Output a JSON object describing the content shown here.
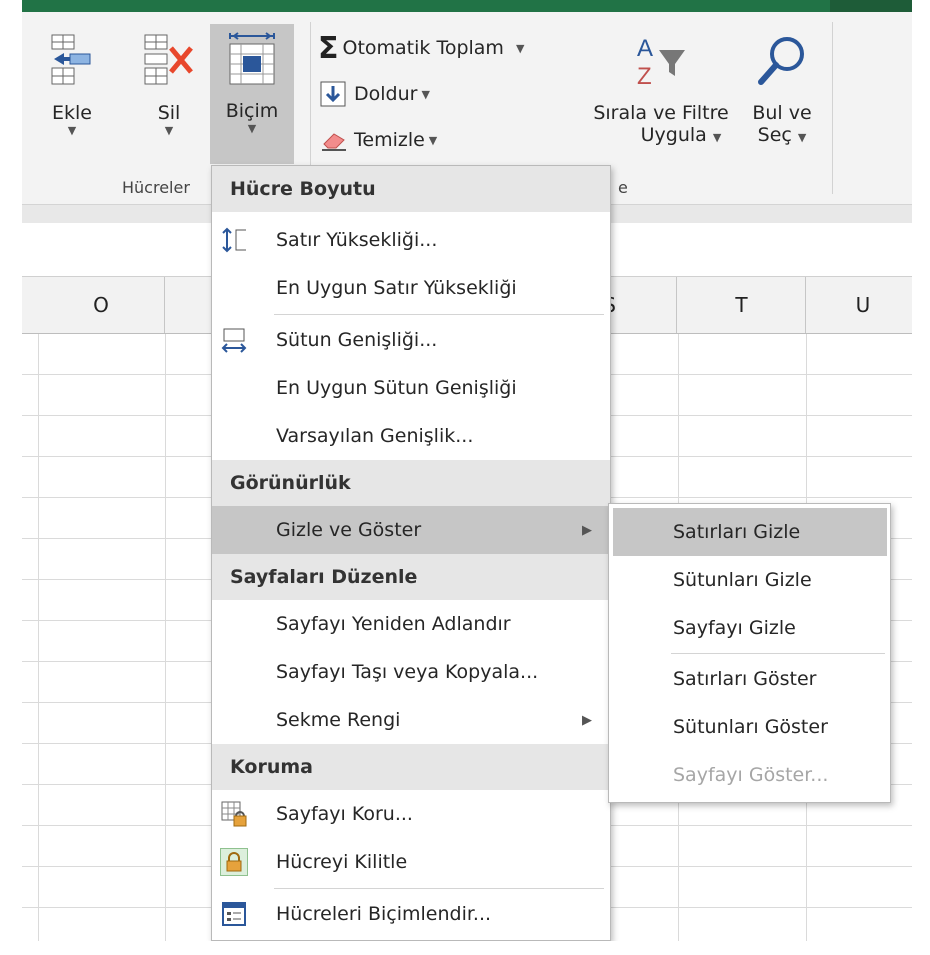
{
  "ribbon": {
    "buttons": {
      "insert": "Ekle",
      "delete": "Sil",
      "format": "Biçim",
      "autosum": "Otomatik Toplam",
      "fill": "Doldur",
      "clear": "Temizle",
      "sort_line1": "Sırala ve Filtre",
      "sort_line2": "Uygula",
      "find_line1": "Bul ve",
      "find_line2": "Seç"
    },
    "groups": {
      "cells": "Hücreler",
      "editing_partial": "e"
    }
  },
  "columns": [
    "O",
    "",
    "",
    "S",
    "T",
    "U"
  ],
  "format_menu": {
    "sections": {
      "cell_size": "Hücre Boyutu",
      "visibility": "Görünürlük",
      "organize_sheets": "Sayfaları Düzenle",
      "protection": "Koruma"
    },
    "items": {
      "row_height": "Satır Yüksekliği...",
      "autofit_row_height": "En Uygun Satır Yüksekliği",
      "column_width": "Sütun Genişliği...",
      "autofit_column_width": "En Uygun Sütun Genişliği",
      "default_width": "Varsayılan Genişlik...",
      "hide_unhide": "Gizle ve Göster",
      "rename_sheet": "Sayfayı Yeniden Adlandır",
      "move_copy_sheet": "Sayfayı Taşı veya Kopyala...",
      "tab_color": "Sekme Rengi",
      "protect_sheet": "Sayfayı Koru...",
      "lock_cell": "Hücreyi Kilitle",
      "format_cells": "Hücreleri Biçimlendir..."
    }
  },
  "submenu": {
    "hide_rows": "Satırları Gizle",
    "hide_columns": "Sütunları Gizle",
    "hide_sheet": "Sayfayı Gizle",
    "unhide_rows": "Satırları Göster",
    "unhide_columns": "Sütunları Göster",
    "unhide_sheet": "Sayfayı Göster..."
  },
  "colors": {
    "excel_green": "#217346",
    "accent_blue": "#2b579a",
    "hover_gray": "#c6c6c6",
    "disabled_text": "#a6a6a6"
  }
}
